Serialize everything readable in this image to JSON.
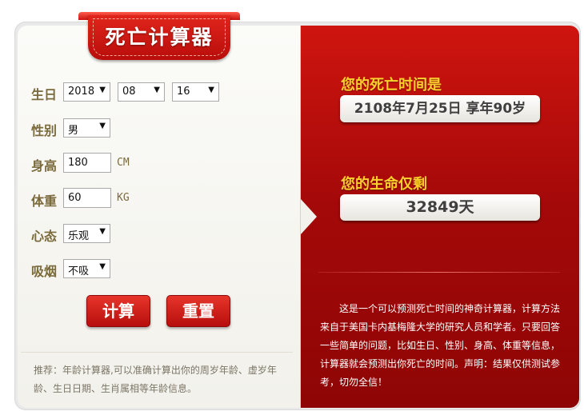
{
  "title": "死亡计算器",
  "form": {
    "birthday": {
      "label": "生日",
      "year": "2018",
      "month": "08",
      "day": "16"
    },
    "gender": {
      "label": "性别",
      "value": "男"
    },
    "height": {
      "label": "身高",
      "value": "180",
      "unit": "CM"
    },
    "weight": {
      "label": "体重",
      "value": "60",
      "unit": "KG"
    },
    "mood": {
      "label": "心态",
      "value": "乐观"
    },
    "smoking": {
      "label": "吸烟",
      "value": "不吸"
    }
  },
  "buttons": {
    "calculate": "计算",
    "reset": "重置"
  },
  "tip": "推荐：年龄计算器,可以准确计算出你的周岁年龄、虚岁年龄、生日日期、生肖属相等年龄信息。",
  "result": {
    "death_heading": "您的死亡时间是",
    "death_value": "2108年7月25日 享年90岁",
    "remaining_heading": "您的生命仅剩",
    "remaining_value": "32849天"
  },
  "description": "这是一个可以预测死亡时间的神奇计算器，计算方法来自于美国卡内基梅隆大学的研究人员和学者。只要回答一些简单的问题，比如生日、性别、身高、体重等信息，计算器就会预测出你死亡的时间。声明：结果仅供测试参考，切勿全信！",
  "colors": {
    "accent_red": "#c81410",
    "heading_yellow": "#ffd02c",
    "label_brown": "#7a6a3c"
  },
  "icons": {
    "dropdown": "caret-down-icon"
  }
}
